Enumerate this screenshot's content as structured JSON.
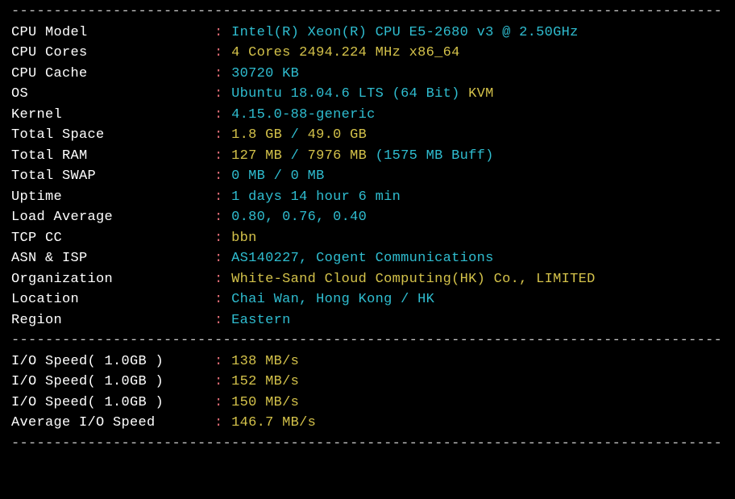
{
  "divider": "----------------------------------------------------------------------------------------",
  "sysinfo": [
    {
      "label": "CPU Model",
      "parts": [
        {
          "cls": "cyan",
          "text": "Intel(R) Xeon(R) CPU E5-2680 v3 @ 2.50GHz"
        }
      ]
    },
    {
      "label": "CPU Cores",
      "parts": [
        {
          "cls": "yellow",
          "text": "4 Cores 2494.224 MHz x86_64"
        }
      ]
    },
    {
      "label": "CPU Cache",
      "parts": [
        {
          "cls": "cyan",
          "text": "30720 KB"
        }
      ]
    },
    {
      "label": "OS",
      "parts": [
        {
          "cls": "cyan",
          "text": "Ubuntu 18.04.6 LTS (64 Bit) "
        },
        {
          "cls": "yellow",
          "text": "KVM"
        }
      ]
    },
    {
      "label": "Kernel",
      "parts": [
        {
          "cls": "cyan",
          "text": "4.15.0-88-generic"
        }
      ]
    },
    {
      "label": "Total Space",
      "parts": [
        {
          "cls": "yellow",
          "text": "1.8 GB "
        },
        {
          "cls": "cyan",
          "text": "/ "
        },
        {
          "cls": "yellow",
          "text": "49.0 GB"
        }
      ]
    },
    {
      "label": "Total RAM",
      "parts": [
        {
          "cls": "yellow",
          "text": "127 MB "
        },
        {
          "cls": "cyan",
          "text": "/ "
        },
        {
          "cls": "yellow",
          "text": "7976 MB "
        },
        {
          "cls": "cyan",
          "text": "(1575 MB Buff)"
        }
      ]
    },
    {
      "label": "Total SWAP",
      "parts": [
        {
          "cls": "cyan",
          "text": "0 MB / 0 MB"
        }
      ]
    },
    {
      "label": "Uptime",
      "parts": [
        {
          "cls": "cyan",
          "text": "1 days 14 hour 6 min"
        }
      ]
    },
    {
      "label": "Load Average",
      "parts": [
        {
          "cls": "cyan",
          "text": "0.80, 0.76, 0.40"
        }
      ]
    },
    {
      "label": "TCP CC",
      "parts": [
        {
          "cls": "yellow",
          "text": "bbn"
        }
      ]
    },
    {
      "label": "ASN & ISP",
      "parts": [
        {
          "cls": "cyan",
          "text": "AS140227, Cogent Communications"
        }
      ]
    },
    {
      "label": "Organization",
      "parts": [
        {
          "cls": "yellow",
          "text": "White-Sand Cloud Computing(HK) Co., LIMITED"
        }
      ]
    },
    {
      "label": "Location",
      "parts": [
        {
          "cls": "cyan",
          "text": "Chai Wan, Hong Kong / HK"
        }
      ]
    },
    {
      "label": "Region",
      "parts": [
        {
          "cls": "cyan",
          "text": "Eastern"
        }
      ]
    }
  ],
  "io": [
    {
      "label": "I/O Speed( 1.0GB )",
      "value": "138 MB/s"
    },
    {
      "label": "I/O Speed( 1.0GB )",
      "value": "152 MB/s"
    },
    {
      "label": "I/O Speed( 1.0GB )",
      "value": "150 MB/s"
    },
    {
      "label": "Average I/O Speed",
      "value": "146.7 MB/s"
    }
  ],
  "colon": ":",
  "label_width": 24
}
